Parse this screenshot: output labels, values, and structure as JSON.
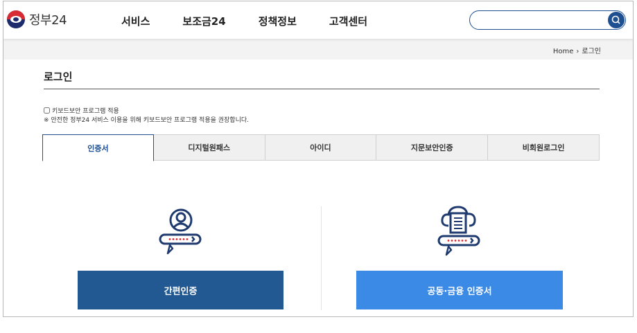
{
  "header": {
    "logo_text": "정부24",
    "nav": [
      "서비스",
      "보조금24",
      "정책정보",
      "고객센터"
    ],
    "search": {
      "value": "",
      "placeholder": ""
    }
  },
  "breadcrumb": {
    "home": "Home",
    "separator": "›",
    "current": "로그인"
  },
  "page": {
    "title": "로그인",
    "keyboard_security_label": "키보드보안 프로그램 적용",
    "notice": "※ 안전한 정부24 서비스 이용을 위해 키보드보안 프로그램 적용을 권장합니다."
  },
  "tabs": [
    {
      "label": "인증서",
      "active": true
    },
    {
      "label": "디지털원패스",
      "active": false
    },
    {
      "label": "아이디",
      "active": false
    },
    {
      "label": "지문보안인증",
      "active": false
    },
    {
      "label": "비회원로그인",
      "active": false
    }
  ],
  "options": {
    "simple_auth": {
      "label": "간편인증",
      "icon": "person-key-icon",
      "color": "#225992"
    },
    "joint_cert": {
      "label": "공동·금융 인증서",
      "icon": "cloud-document-key-icon",
      "color": "#3a8ae6"
    }
  },
  "colors": {
    "brand": "#1d4f91",
    "accent_red": "#d92b34"
  }
}
